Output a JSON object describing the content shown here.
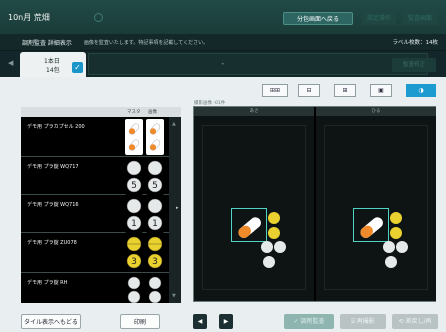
{
  "header": {
    "title": "10n月 荒畑",
    "primary_button": "分包画面へ戻る",
    "dim_button_1": "設定操作",
    "dim_button_2": "監査画面"
  },
  "subheader": {
    "title": "調剤監査 詳細表示",
    "message": "画像を監査いたします。特記事項を記載してください。",
    "count": "ラベル枚数：14枚"
  },
  "day_tab": {
    "line1": "1本日",
    "line2": "14包",
    "checked": true,
    "check_glyph": "✓",
    "strip_text": "•"
  },
  "tab_action_button": "監査修正",
  "view_toolbar": {
    "buttons": [
      "⊞⊞",
      "⊟",
      "⊞",
      "▣",
      "◑"
    ],
    "active_index": 4
  },
  "list": {
    "headers": [
      "マスタ",
      "画像"
    ],
    "rows": [
      {
        "name": "デモ用 プラカプセル 200",
        "pill_type": "capsule"
      },
      {
        "name": "デモ用 プラ錠 WQ717",
        "pill_type": "white_number",
        "label": "5"
      },
      {
        "name": "デモ用 プラ錠 WQ716",
        "pill_type": "white_number",
        "label": "1"
      },
      {
        "name": "デモ用 プラ錠 ZU078",
        "pill_type": "yellow_number",
        "label": "3"
      },
      {
        "name": "デモ用 プラ錠 RH",
        "pill_type": "white_plain"
      }
    ],
    "scroll_up": "▲",
    "scroll_down": "▼",
    "side_arrow": "▸"
  },
  "comparison": {
    "label": "撮影画像 -01件",
    "columns": [
      "あさ",
      "ひる"
    ]
  },
  "bottom": {
    "left_button": "タイル表示へもどる",
    "print_button": "印刷",
    "prev": "◀",
    "next": "▶",
    "audit_ok": "✓ 調剤監査",
    "rescan": "⌸ 再撮影",
    "revert": "⟲ 差戻し/再"
  },
  "colors": {
    "accent": "#1c9bd0",
    "capsule_orange": "#f08a2a",
    "pill_yellow": "#e9d130",
    "select_box": "#4fd4c4"
  }
}
